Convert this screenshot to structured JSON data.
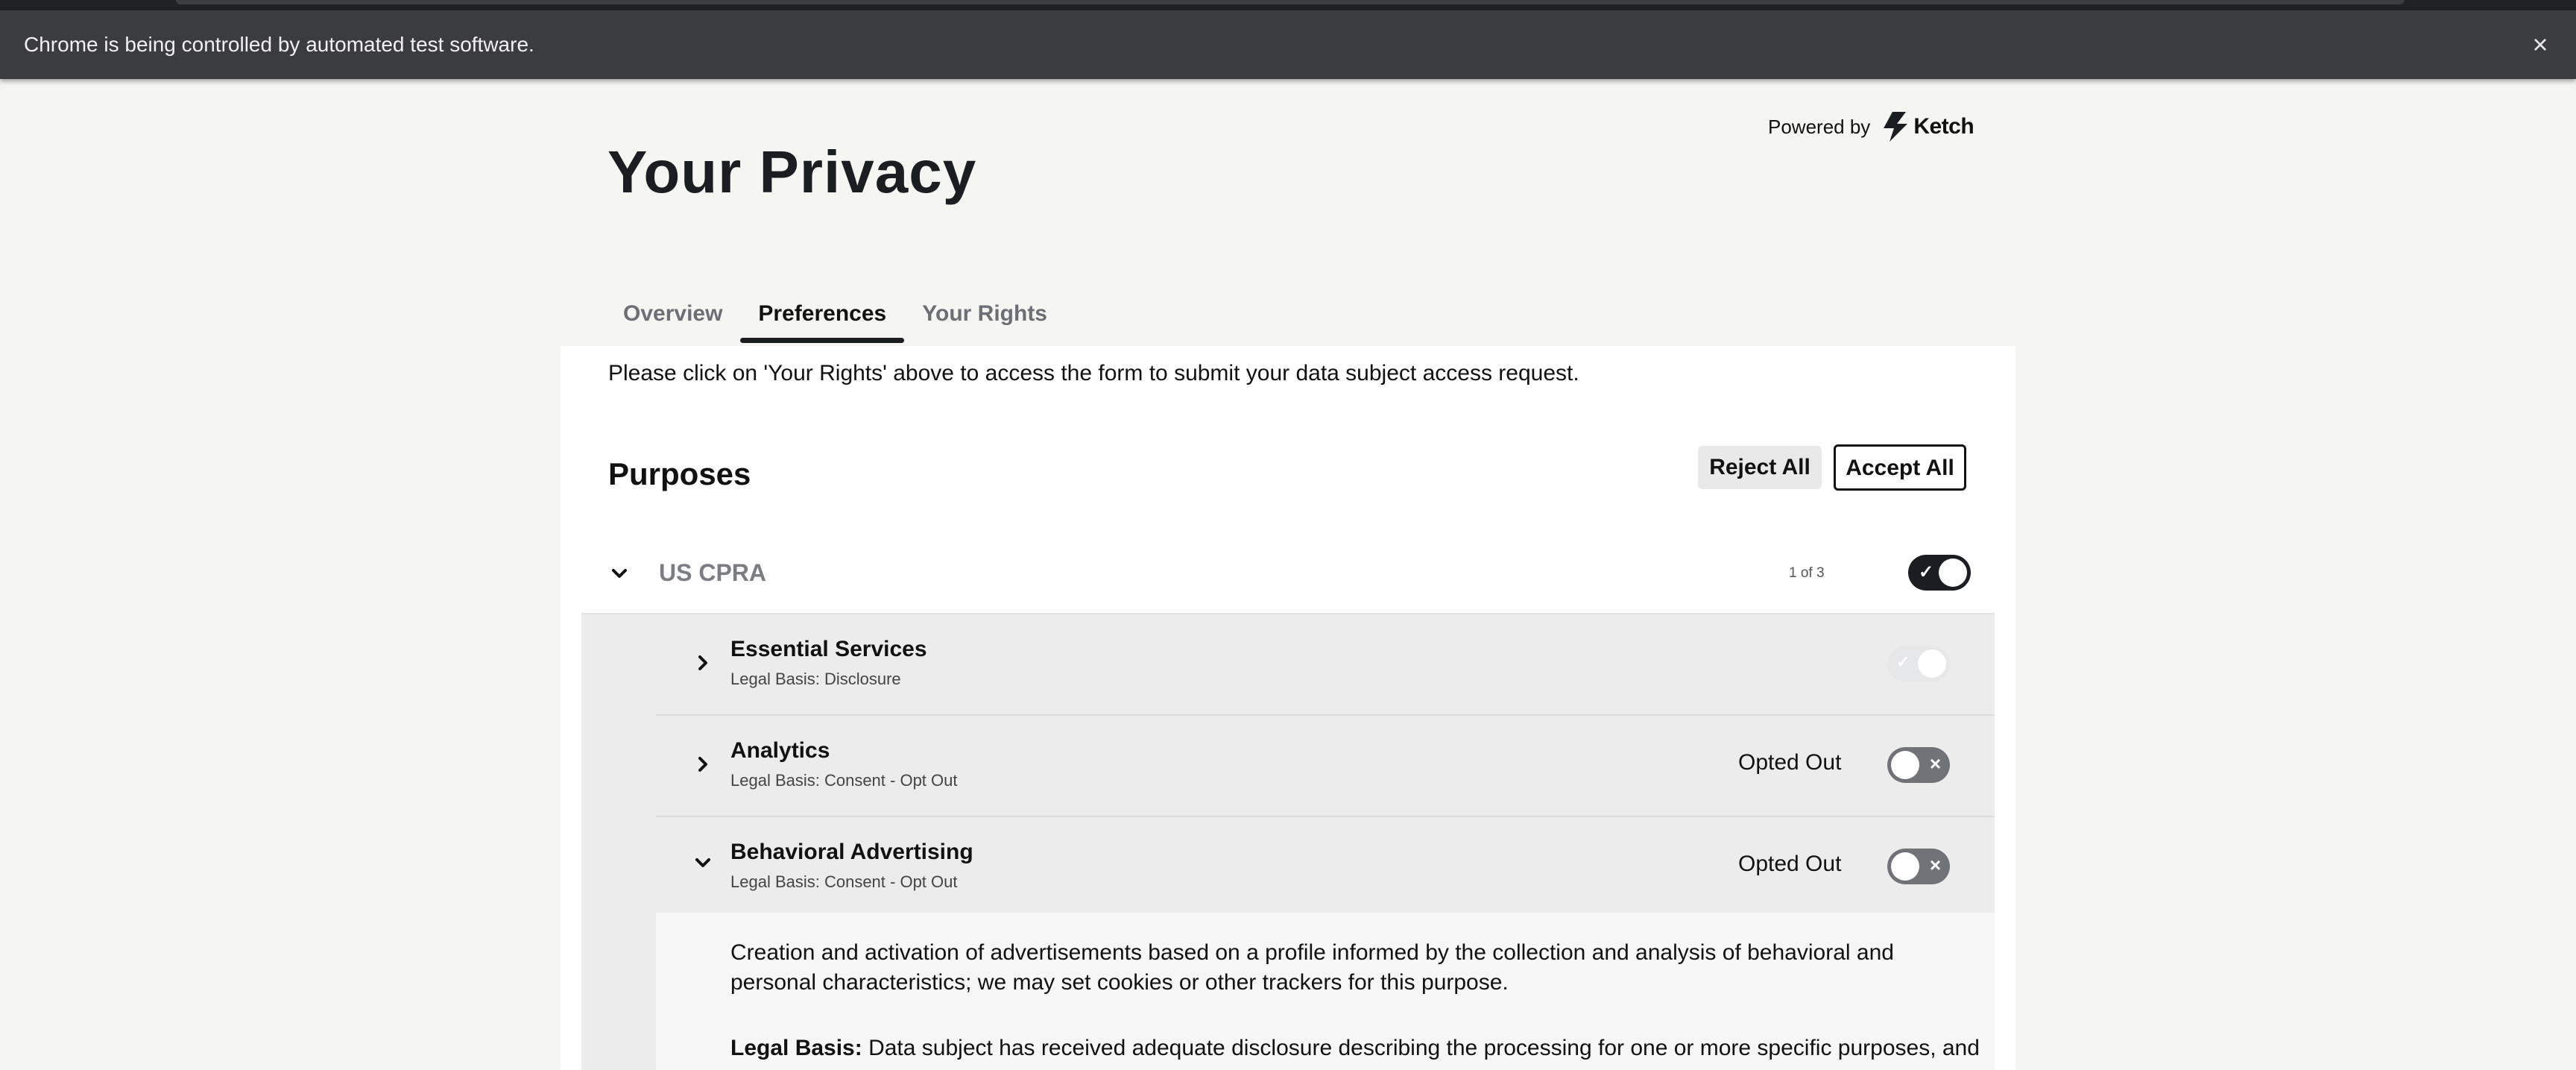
{
  "infobar": {
    "message": "Chrome is being controlled by automated test software.",
    "close_glyph": "×"
  },
  "powered": {
    "label": "Powered by",
    "brand": "Ketch"
  },
  "page": {
    "title": "Your Privacy"
  },
  "tabs": [
    {
      "label": "Overview",
      "active": false
    },
    {
      "label": "Preferences",
      "active": true
    },
    {
      "label": "Your Rights",
      "active": false
    }
  ],
  "notice": "Please click on 'Your Rights' above to access the form to submit your data subject access request.",
  "purposes": {
    "title": "Purposes",
    "reject_all": "Reject All",
    "accept_all": "Accept All",
    "group": {
      "label": "US CPRA",
      "count": "1 of 3",
      "expanded": true,
      "toggle": "on"
    },
    "items": [
      {
        "title": "Essential Services",
        "basis": "Legal Basis: Disclosure",
        "status": "",
        "toggle": "disabled",
        "expanded": false
      },
      {
        "title": "Analytics",
        "basis": "Legal Basis: Consent - Opt Out",
        "status": "Opted Out",
        "toggle": "off",
        "expanded": false
      },
      {
        "title": "Behavioral Advertising",
        "basis": "Legal Basis: Consent - Opt Out",
        "status": "Opted Out",
        "toggle": "off",
        "expanded": true
      }
    ],
    "detail": {
      "description": "Creation and activation of advertisements based on a profile informed by the collection and analysis of behavioral and personal characteristics; we may set cookies or other trackers for this purpose.",
      "basis_label": "Legal Basis:",
      "basis_text": "Data subject has received adequate disclosure describing the processing for one or more specific purposes, and"
    }
  },
  "colors": {
    "background": "#f5f5f2",
    "infobar": "#3b3c3f",
    "toggle_on": "#1a1d21",
    "toggle_off": "#6f7378",
    "sub_area": "#ececed"
  }
}
